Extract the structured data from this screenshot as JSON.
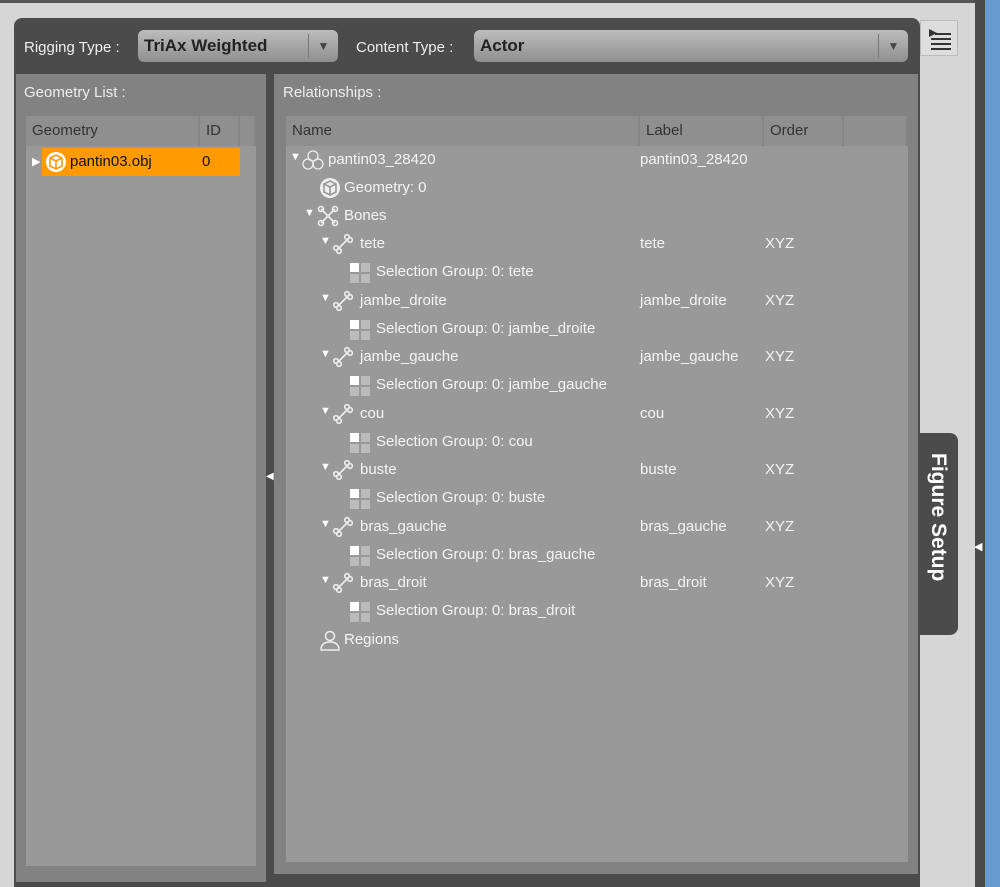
{
  "header": {
    "rigging_label": "Rigging Type :",
    "rigging_value": "TriAx Weighted",
    "content_label": "Content Type :",
    "content_value": "Actor"
  },
  "geometry": {
    "title": "Geometry List :",
    "columns": [
      "Geometry",
      "ID"
    ],
    "rows": [
      {
        "name": "pantin03.obj",
        "id": "0"
      }
    ]
  },
  "relationships": {
    "title": "Relationships :",
    "columns": [
      "Name",
      "Label",
      "Order"
    ],
    "root": {
      "name": "pantin03_28420",
      "label": "pantin03_28420"
    },
    "geometry_node": "Geometry: 0",
    "bones_node": "Bones",
    "regions_node": "Regions",
    "bones": [
      {
        "name": "tete",
        "label": "tete",
        "order": "XYZ",
        "group": "Selection Group: 0: tete"
      },
      {
        "name": "jambe_droite",
        "label": "jambe_droite",
        "order": "XYZ",
        "group": "Selection Group: 0: jambe_droite"
      },
      {
        "name": "jambe_gauche",
        "label": "jambe_gauche",
        "order": "XYZ",
        "group": "Selection Group: 0: jambe_gauche"
      },
      {
        "name": "cou",
        "label": "cou",
        "order": "XYZ",
        "group": "Selection Group: 0: cou"
      },
      {
        "name": "buste",
        "label": "buste",
        "order": "XYZ",
        "group": "Selection Group: 0: buste"
      },
      {
        "name": "bras_gauche",
        "label": "bras_gauche",
        "order": "XYZ",
        "group": "Selection Group: 0: bras_gauche"
      },
      {
        "name": "bras_droit",
        "label": "bras_droit",
        "order": "XYZ",
        "group": "Selection Group: 0: bras_droit"
      }
    ]
  },
  "side_tab": "Figure Setup",
  "colors": {
    "selection": "#ff9a00",
    "panel": "#828282",
    "list": "#999999"
  }
}
